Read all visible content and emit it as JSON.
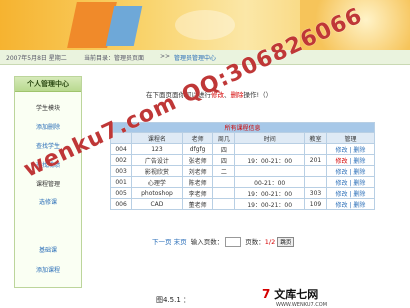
{
  "header": {
    "date": "2007年5月8日 星期二",
    "location_label": "当前目录：管理员页面",
    "sep": ">>",
    "current": "管理员管理中心"
  },
  "sidebar": {
    "title": "个人管理中心",
    "items": [
      {
        "label": "学生模块",
        "type": "section"
      },
      {
        "label": "添加删除",
        "type": "link"
      },
      {
        "label": "查找学生",
        "type": "link"
      },
      {
        "label": "查找成绩",
        "type": "link"
      },
      {
        "label": "课程管理",
        "type": "section"
      },
      {
        "label": "选修课",
        "type": "link"
      },
      {
        "label": "基础课",
        "type": "link"
      },
      {
        "label": "添加课程",
        "type": "link"
      }
    ]
  },
  "notice": {
    "before": "在下面",
    "mid": "页面你可以进行",
    "edit": "修改",
    "sep": "、",
    "del": "删除",
    "after": "操作!（）"
  },
  "table": {
    "caption": "所有课程信息",
    "headers": [
      "",
      "课程名",
      "老师",
      "周几",
      "时间",
      "教室",
      "管理"
    ],
    "rows": [
      {
        "id": "004",
        "name": "123",
        "teacher": "dfgfg",
        "day": "四",
        "time": "",
        "room": "",
        "edit": "修改",
        "del": "删除"
      },
      {
        "id": "002",
        "name": "广告设计",
        "teacher": "张老师",
        "day": "四",
        "time": "19：00-21：00",
        "room": "201",
        "edit": "修改",
        "del": "删除"
      },
      {
        "id": "003",
        "name": "影视欣赏",
        "teacher": "刘老师",
        "day": "二",
        "time": "",
        "room": "",
        "edit": "修改",
        "del": "删除"
      },
      {
        "id": "001",
        "name": "心理学",
        "teacher": "陈老师",
        "day": "",
        "time": "00-21：00",
        "room": "",
        "edit": "修改",
        "del": "删除"
      },
      {
        "id": "005",
        "name": "photoshop",
        "teacher": "李老师",
        "day": "",
        "time": "19：00-21：00",
        "room": "303",
        "edit": "修改",
        "del": "删除"
      },
      {
        "id": "006",
        "name": "CAD",
        "teacher": "董老师",
        "day": "",
        "time": "19：00-21：00",
        "room": "109",
        "edit": "修改",
        "del": "删除"
      }
    ]
  },
  "pager": {
    "next": "下一页",
    "last": "末页",
    "goto_label": "输入页数：",
    "page_info": "页数：",
    "page_value": "1/2",
    "button": "跳页"
  },
  "footer": {
    "caption": "图4.5.1 ：",
    "brand_logo": "7",
    "brand_text": "文库七网",
    "brand_url": "WWW.WENKU7.COM"
  },
  "watermark": "wenku7.com QQ:306826066"
}
